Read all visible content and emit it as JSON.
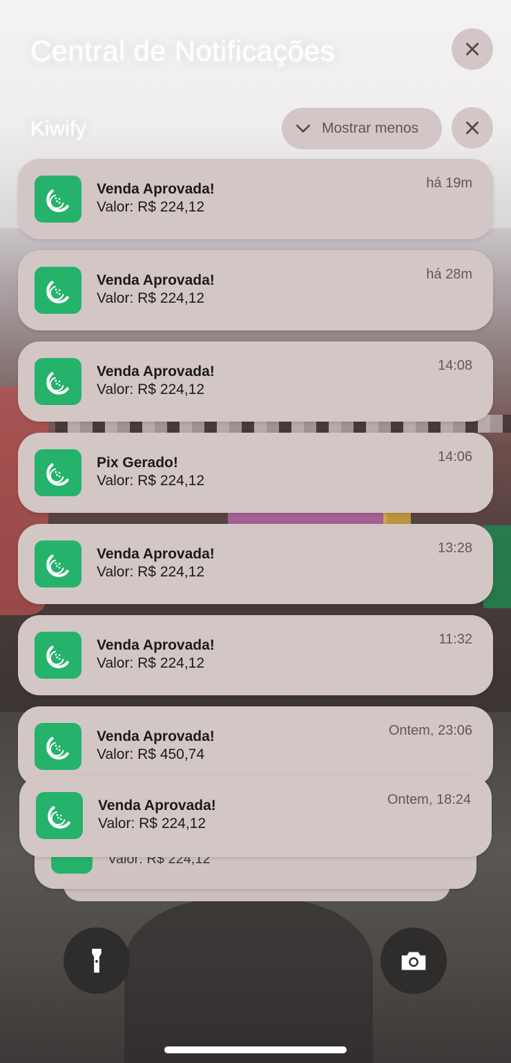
{
  "header": {
    "title": "Central de Notificações",
    "close_icon": "close-icon"
  },
  "group": {
    "app_name": "Kiwify",
    "show_less_label": "Mostrar menos",
    "show_less_icon": "chevron-down-icon",
    "dismiss_icon": "close-icon"
  },
  "notifications": [
    {
      "title": "Venda Aprovada!",
      "body": "Valor: R$ 224,12",
      "time": "há 19m"
    },
    {
      "title": "Venda Aprovada!",
      "body": "Valor: R$ 224,12",
      "time": "há 28m"
    },
    {
      "title": "Venda Aprovada!",
      "body": "Valor: R$ 224,12",
      "time": "14:08"
    },
    {
      "title": "Pix Gerado!",
      "body": "Valor: R$ 224,12",
      "time": "14:06"
    },
    {
      "title": "Venda Aprovada!",
      "body": "Valor: R$ 224,12",
      "time": "13:28"
    },
    {
      "title": "Venda Aprovada!",
      "body": "Valor: R$ 224,12",
      "time": "11:32"
    },
    {
      "title": "Venda Aprovada!",
      "body": "Valor: R$ 450,74",
      "time": "Ontem, 23:06"
    },
    {
      "title": "Venda Aprovada!",
      "body": "Valor: R$ 224,12",
      "time": "Ontem, 18:24"
    }
  ],
  "stacked": {
    "body": "Valor: R$ 224,12"
  },
  "colors": {
    "accent": "#25b26b",
    "card": "#d3c7c6",
    "pill": "#d3c6c6"
  },
  "bottom": {
    "left_icon": "flashlight-icon",
    "right_icon": "camera-icon"
  }
}
